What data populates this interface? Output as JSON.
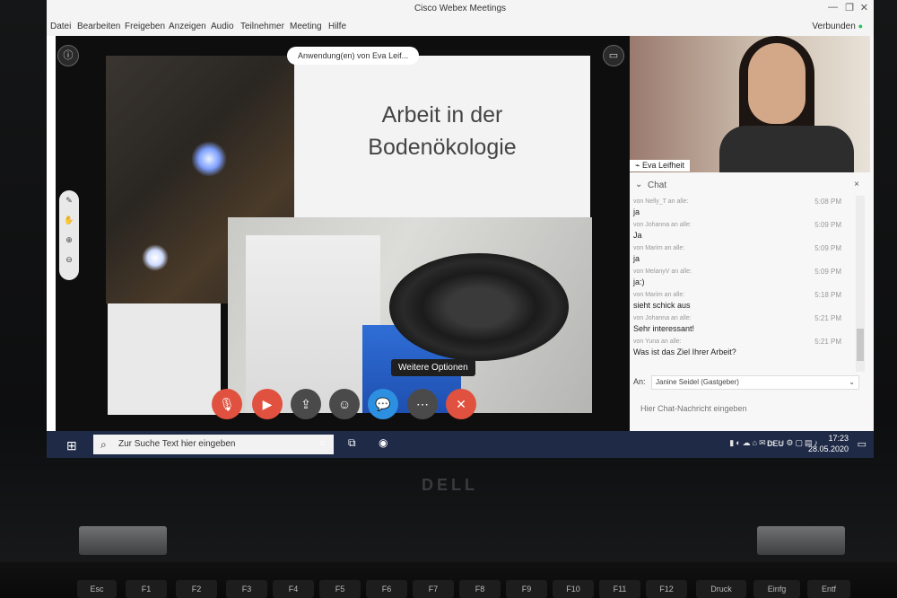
{
  "app": {
    "title": "Cisco Webex Meetings",
    "window_controls": [
      "—",
      "❐",
      "✕"
    ]
  },
  "menu": {
    "items": [
      "Datei",
      "Bearbeiten",
      "Freigeben",
      "Anzeigen",
      "Audio",
      "Teilnehmer",
      "Meeting",
      "Hilfe"
    ],
    "status": "Verbunden"
  },
  "share": {
    "tab_label": "Anwendung(en) von Eva Leif...",
    "slide_title_line1": "Arbeit in der",
    "slide_title_line2": "Bodenökologie"
  },
  "tooltip": "Weitere Optionen",
  "controls": [
    "mute",
    "video",
    "share",
    "participants",
    "chat",
    "more",
    "leave"
  ],
  "participant": {
    "name": "Eva Leifheit"
  },
  "chat": {
    "header": "Chat",
    "messages": [
      {
        "from": "von Nelly_T an alle:",
        "time": "5:08 PM",
        "text": "ja"
      },
      {
        "from": "von Johanna an alle:",
        "time": "5:09 PM",
        "text": "Ja"
      },
      {
        "from": "von Marim an alle:",
        "time": "5:09 PM",
        "text": "ja"
      },
      {
        "from": "von MelanyV an alle:",
        "time": "5:09 PM",
        "text": "ja:)"
      },
      {
        "from": "von Marim an alle:",
        "time": "5:18 PM",
        "text": "sieht schick aus"
      },
      {
        "from": "von Johanna an alle:",
        "time": "5:21 PM",
        "text": "Sehr interessant!"
      },
      {
        "from": "von Yuna an alle:",
        "time": "5:21 PM",
        "text": "Was ist das Ziel Ihrer Arbeit?"
      }
    ],
    "to_label": "An:",
    "to_value": "Janine Seidel (Gastgeber)",
    "input_placeholder": "Hier Chat-Nachricht eingeben"
  },
  "taskbar": {
    "search_placeholder": "Zur Suche Text hier eingeben",
    "lang": "DEU",
    "time": "17:23",
    "date": "28.05.2020"
  },
  "laptop": {
    "brand": "DELL"
  },
  "keys": [
    "Esc",
    "F1",
    "F2",
    "F3",
    "F4",
    "F5",
    "F6",
    "F7",
    "F8",
    "F9",
    "F10",
    "F11",
    "F12",
    "Druck",
    "Einfg",
    "Entf"
  ]
}
